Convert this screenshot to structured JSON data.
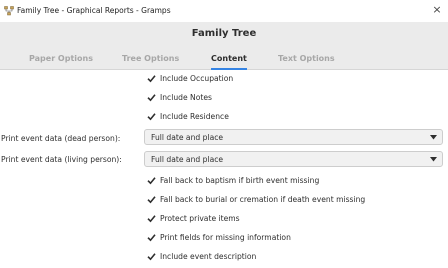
{
  "window": {
    "title": "Family Tree - Graphical Reports - Gramps",
    "close_glyph": "×",
    "app_icon": "gramps-tree-icon"
  },
  "dialog": {
    "title": "Family Tree"
  },
  "tabs": [
    {
      "label": "Paper Options",
      "active": false
    },
    {
      "label": "Tree Options",
      "active": false
    },
    {
      "label": "Content",
      "active": true
    },
    {
      "label": "Text Options",
      "active": false
    }
  ],
  "options": {
    "include_occupation": {
      "label": "Include Occupation",
      "checked": true
    },
    "include_notes": {
      "label": "Include Notes",
      "checked": true
    },
    "include_residence": {
      "label": "Include Residence",
      "checked": true
    },
    "print_event_dead": {
      "label": "Print event data (dead person):",
      "value": "Full date and place"
    },
    "print_event_living": {
      "label": "Print event data (living person):",
      "value": "Full date and place"
    },
    "fallback_baptism": {
      "label": "Fall back to baptism if birth event missing",
      "checked": true
    },
    "fallback_burial": {
      "label": "Fall back to burial or cremation if death event missing",
      "checked": true
    },
    "protect_private": {
      "label": "Protect private items",
      "checked": true
    },
    "print_missing_fields": {
      "label": "Print fields for missing information",
      "checked": true
    },
    "include_event_description": {
      "label": "Include event description",
      "checked": true
    }
  },
  "colors": {
    "accent": "#3584e4",
    "header_bg": "#ebebeb",
    "inactive_tab": "#a7a7a7",
    "text": "#2e2e2e"
  }
}
